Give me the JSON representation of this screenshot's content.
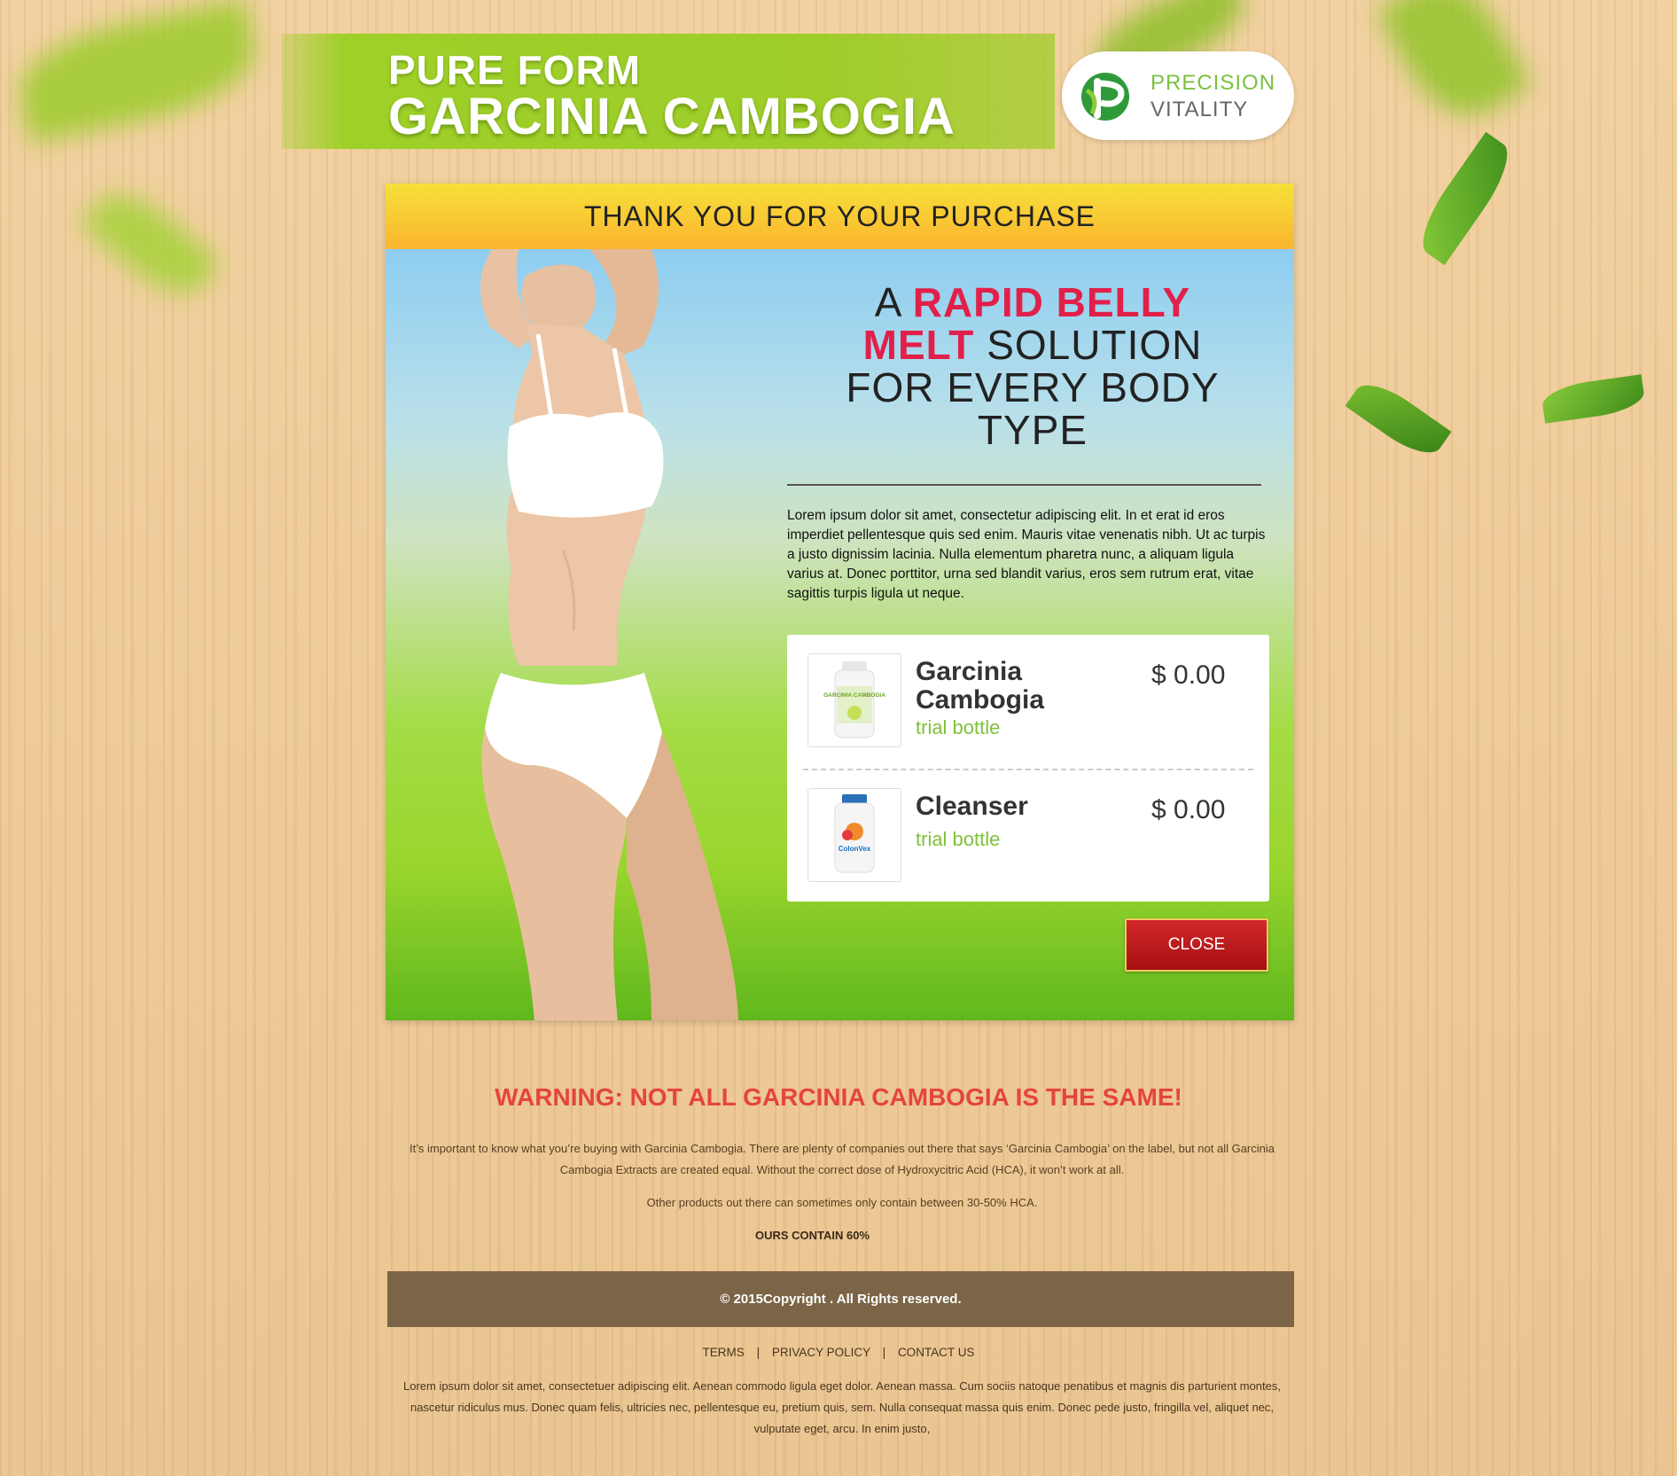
{
  "brand": {
    "line1": "PURE FORM",
    "line2": "GARCINIA CAMBOGIA"
  },
  "logo": {
    "line1": "PRECISION",
    "line2": "VITALITY",
    "icon": "precision-vitality-logo-icon"
  },
  "panel": {
    "header": "THANK YOU FOR YOUR PURCHASE",
    "headline": {
      "prefix": "A",
      "highlight1": "RAPID BELLY",
      "highlight2": "MELT",
      "suffix1": "SOLUTION",
      "suffix2": "FOR EVERY BODY",
      "suffix3": "TYPE"
    },
    "body": "Lorem ipsum dolor sit amet, consectetur adipiscing elit. In et erat id eros imperdiet pellentesque quis sed enim. Mauris vitae venenatis nibh. Ut ac turpis a justo dignissim lacinia. Nulla elementum pharetra nunc, a aliquam ligula varius at. Donec porttitor, urna sed blandit varius, eros sem rutrum erat, vitae sagittis turpis ligula ut neque.",
    "items": [
      {
        "name": "Garcinia Cambogia",
        "subtitle": "trial bottle",
        "price": "$ 0.00",
        "bottle_label": "GARCINIA CAMBOGIA"
      },
      {
        "name": "Cleanser",
        "subtitle": "trial bottle",
        "price": "$ 0.00",
        "bottle_label": "ColonVex"
      }
    ],
    "close_label": "CLOSE"
  },
  "warning": {
    "title": "WARNING: NOT ALL GARCINIA CAMBOGIA IS THE SAME!",
    "paragraph1": "It’s important to know what you’re buying with Garcinia Cambogia. There are plenty of companies out there that says ‘Garcinia Cambogia’ on the label, but not all Garcinia Cambogia Extracts are created equal. Without the correct dose of Hydroxycitric Acid (HCA), it won’t work at all.",
    "paragraph2": "Other products out there can sometimes only contain between 30-50% HCA.",
    "emphasis": "OURS CONTAIN 60%"
  },
  "footer": {
    "copyright": "© 2015Copyright . All Rights reserved.",
    "links": [
      "TERMS",
      "PRIVACY POLICY",
      "CONTACT US"
    ],
    "separator": "|",
    "text": "Lorem ipsum dolor sit amet, consectetuer adipiscing elit. Aenean commodo ligula eget dolor. Aenean massa. Cum sociis natoque penatibus et magnis dis parturient montes, nascetur ridiculus mus. Donec quam felis, ultricies nec, pellentesque eu, pretium quis, sem. Nulla consequat massa quis enim. Donec pede justo, fringilla vel, aliquet nec, vulputate eget, arcu. In enim justo,"
  },
  "colors": {
    "accent_green": "#9ecd2a",
    "headline_red": "#e1204a",
    "warning_red": "#e5453b",
    "button_red": "#b8191c",
    "footer_brown": "#7b6546"
  }
}
